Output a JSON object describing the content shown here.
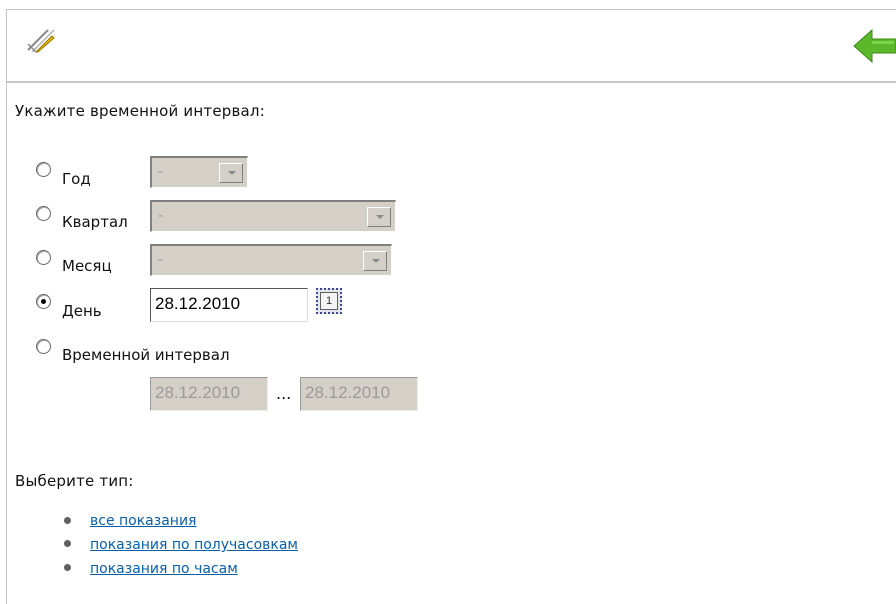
{
  "toolbar": {
    "edit_icon": "pencil-ruler-icon",
    "back_icon": "green-left-arrow-icon"
  },
  "period": {
    "heading": "Укажите временной интервал:",
    "options": [
      {
        "label": "Год",
        "selected": false,
        "value": "-"
      },
      {
        "label": "Квартал",
        "selected": false,
        "value": "-"
      },
      {
        "label": "Месяц",
        "selected": false,
        "value": "-"
      },
      {
        "label": "День",
        "selected": true,
        "value": "28.12.2010",
        "calendar_label": "1"
      },
      {
        "label": "Временной интервал",
        "selected": false,
        "from": "28.12.2010",
        "separator": "...",
        "to": "28.12.2010"
      }
    ]
  },
  "type": {
    "heading": "Выберите тип:",
    "links": [
      "все показания",
      "показания по получасовкам",
      "показания по часам"
    ]
  },
  "colors": {
    "link": "#0b5fa8",
    "arrow": "#5cb82a",
    "disabled": "#d4d0c8"
  }
}
